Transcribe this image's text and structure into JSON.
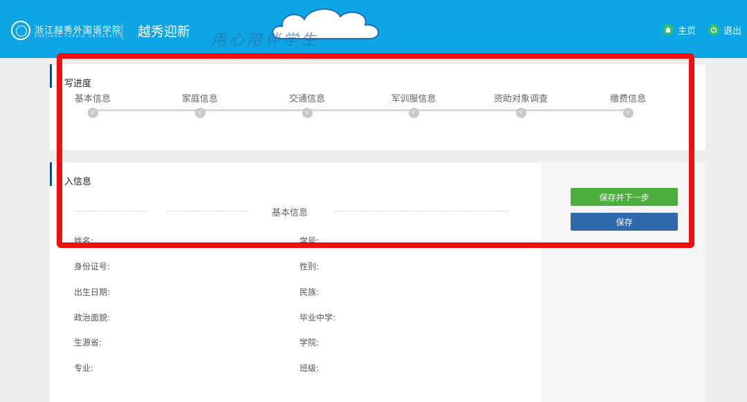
{
  "header": {
    "school_name": "浙江越秀外国语学院",
    "school_subtitle": "ZHEJIANG YUEXIU UNIVERSITY",
    "app_title": "越秀迎新",
    "slogan": "用心陪伴学生",
    "nav": {
      "home_label": "主页",
      "logout_label": "退出"
    },
    "colors": {
      "header_bg": "#0ea5e6",
      "nav_icon": "#2ec36a"
    }
  },
  "progress": {
    "title": "写进度",
    "steps": [
      {
        "label": "基本信息",
        "mark": "√"
      },
      {
        "label": "家庭信息",
        "mark": "√"
      },
      {
        "label": "交通信息",
        "mark": "√"
      },
      {
        "label": "军训服信息",
        "mark": "√"
      },
      {
        "label": "资助对象调查",
        "mark": "√"
      },
      {
        "label": "缴费信息",
        "mark": "√"
      }
    ]
  },
  "info": {
    "title": "入信息",
    "section_title": "基本信息",
    "fields_left": [
      {
        "label": "姓名:"
      },
      {
        "label": "身份证号:"
      },
      {
        "label": "出生日期:"
      },
      {
        "label": "政治面貌:"
      },
      {
        "label": "生源省:"
      },
      {
        "label": "专业:"
      }
    ],
    "fields_right": [
      {
        "label": "学号:"
      },
      {
        "label": "性别:"
      },
      {
        "label": "民族:"
      },
      {
        "label": "毕业中学:"
      },
      {
        "label": "学院:"
      },
      {
        "label": "班级:"
      }
    ]
  },
  "actions": {
    "save_next_label": "保存并下一步",
    "save_label": "保存",
    "colors": {
      "save_next": "#4caf3d",
      "save": "#2e6aab"
    }
  },
  "annotation": {
    "color": "#ee0f0f"
  }
}
